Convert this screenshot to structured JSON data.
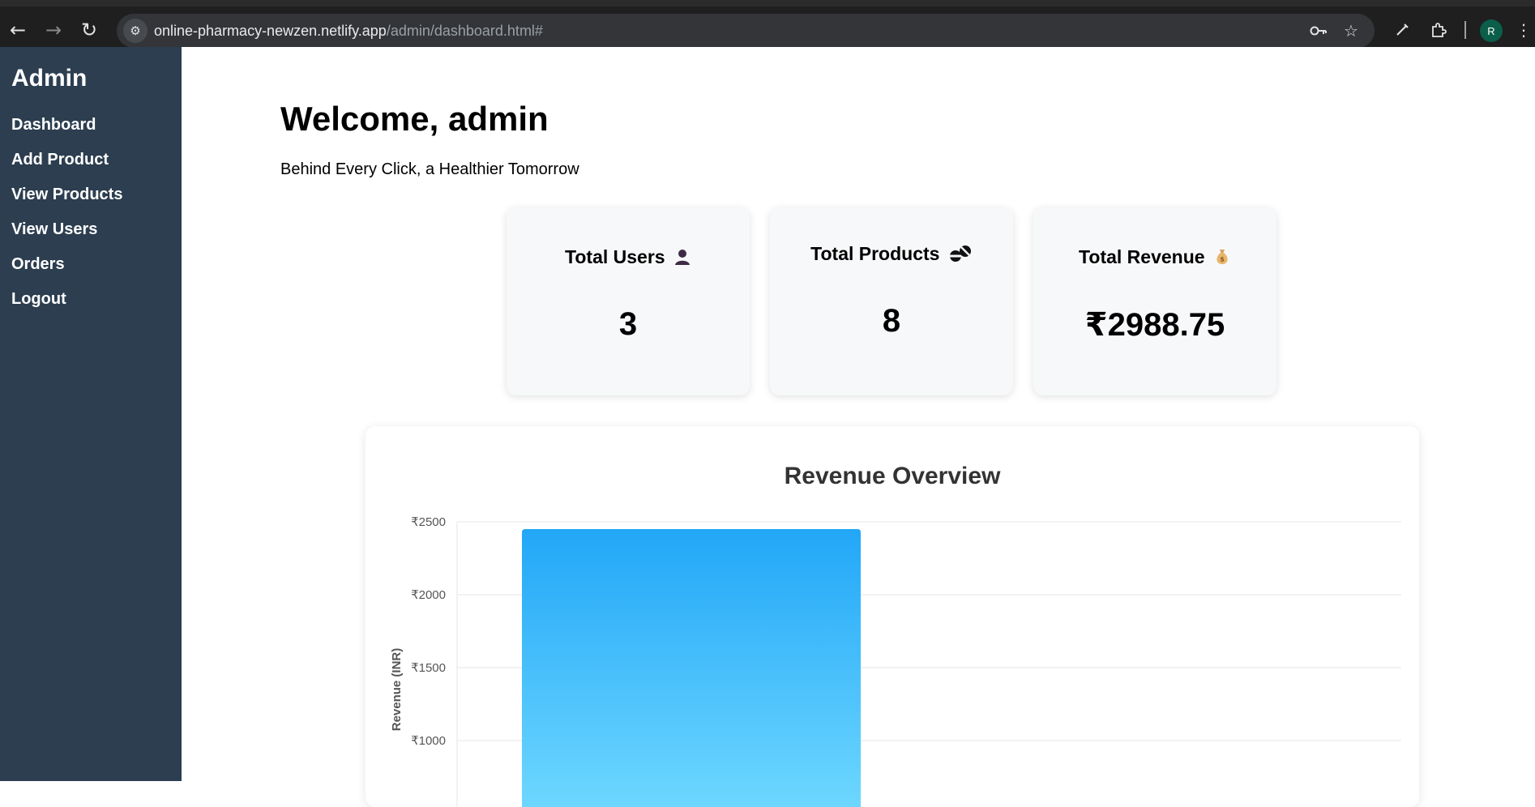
{
  "browser": {
    "url_host": "online-pharmacy-newzen.netlify.app",
    "url_path": "/admin/dashboard.html#",
    "profile_initial": "R"
  },
  "sidebar": {
    "title": "Admin",
    "items": [
      {
        "label": "Dashboard"
      },
      {
        "label": "Add Product"
      },
      {
        "label": "View Products"
      },
      {
        "label": "View Users"
      },
      {
        "label": "Orders"
      },
      {
        "label": "Logout"
      }
    ]
  },
  "main": {
    "welcome": "Welcome, admin",
    "tagline": "Behind Every Click, a Healthier Tomorrow",
    "stats": [
      {
        "title": "Total Users",
        "icon": "bust-in-silhouette-icon",
        "value": "3"
      },
      {
        "title": "Total Products",
        "icon": "pill-icon",
        "value": "8"
      },
      {
        "title": "Total Revenue",
        "icon": "money-bag-icon",
        "value": "₹2988.75"
      }
    ]
  },
  "colors": {
    "sidebar_bg": "#2c3e50",
    "bar_top": "#22a7f7",
    "bar_bottom": "#6fd8ff"
  },
  "chart_data": {
    "type": "bar",
    "title": "Revenue Overview",
    "ylabel": "Revenue (INR)",
    "xlabel": "",
    "ylim": [
      0,
      2500
    ],
    "yticks": [
      2500,
      2000,
      1500,
      1000
    ],
    "ytick_labels": [
      "₹2500",
      "₹2000",
      "₹1500",
      "₹1000"
    ],
    "categories": [
      ""
    ],
    "values": [
      2450
    ],
    "grid": true
  }
}
